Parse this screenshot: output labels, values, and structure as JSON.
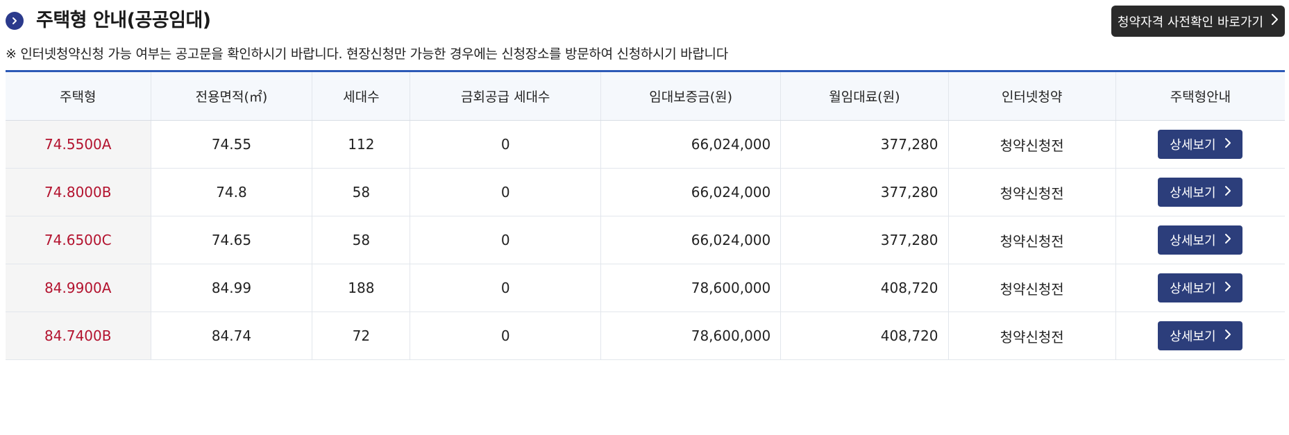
{
  "header": {
    "title": "주택형 안내(공공임대)",
    "eligibility_button": "청약자격 사전확인 바로가기"
  },
  "notice": "※  인터넷청약신청 가능 여부는 공고문을 확인하시기 바랍니다. 현장신청만 가능한 경우에는 신청장소를 방문하여 신청하시기 바랍니다",
  "table": {
    "headers": [
      "주택형",
      "전용면적(㎡)",
      "세대수",
      "금회공급 세대수",
      "임대보증금(원)",
      "월임대료(원)",
      "인터넷청약",
      "주택형안내"
    ],
    "rows": [
      {
        "type": "74.5500A",
        "area": "74.55",
        "households": "112",
        "supply": "0",
        "deposit": "66,024,000",
        "rent": "377,280",
        "status": "청약신청전",
        "detail": "상세보기"
      },
      {
        "type": "74.8000B",
        "area": "74.8",
        "households": "58",
        "supply": "0",
        "deposit": "66,024,000",
        "rent": "377,280",
        "status": "청약신청전",
        "detail": "상세보기"
      },
      {
        "type": "74.6500C",
        "area": "74.65",
        "households": "58",
        "supply": "0",
        "deposit": "66,024,000",
        "rent": "377,280",
        "status": "청약신청전",
        "detail": "상세보기"
      },
      {
        "type": "84.9900A",
        "area": "84.99",
        "households": "188",
        "supply": "0",
        "deposit": "78,600,000",
        "rent": "408,720",
        "status": "청약신청전",
        "detail": "상세보기"
      },
      {
        "type": "84.7400B",
        "area": "84.74",
        "households": "72",
        "supply": "0",
        "deposit": "78,600,000",
        "rent": "408,720",
        "status": "청약신청전",
        "detail": "상세보기"
      }
    ]
  },
  "colors": {
    "title_icon": "#2b3a8c",
    "top_button_bg": "#2a2a2a",
    "header_border": "#2b59b7",
    "type_text": "#b3122e",
    "detail_button_bg": "#2c3e7b"
  },
  "icons": {
    "title": "chevron-right-circle-icon",
    "button": "chevron-right-icon"
  }
}
